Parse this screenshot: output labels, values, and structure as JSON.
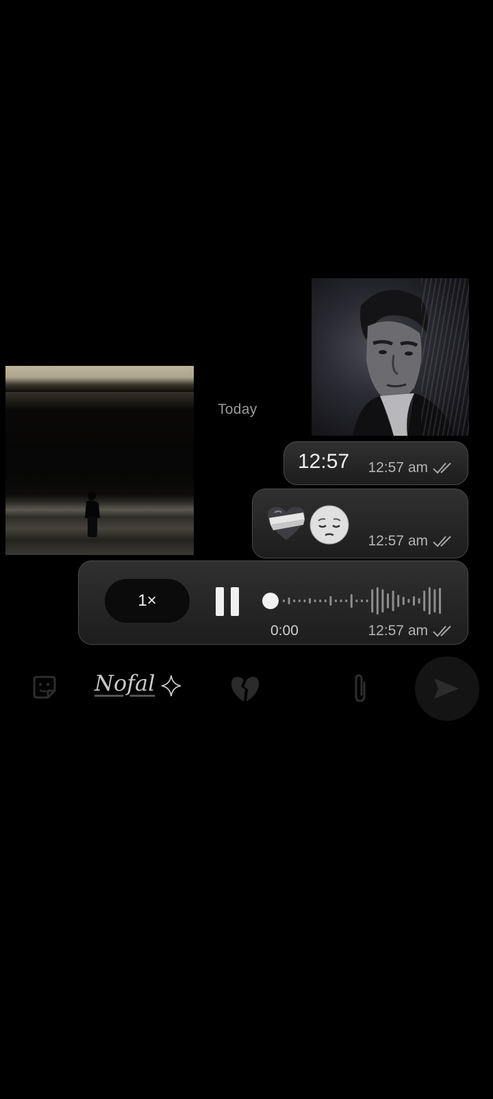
{
  "chat": {
    "date_separator": "Today",
    "messages": [
      {
        "type": "image",
        "side": "right",
        "description_icon": "portrait-photo"
      },
      {
        "type": "image",
        "side": "left",
        "description_icon": "beach-photo"
      },
      {
        "type": "text",
        "side": "right",
        "text": "12:57",
        "time": "12:57 am",
        "status": "read"
      },
      {
        "type": "emoji",
        "side": "right",
        "emojis": [
          "mending-heart-emoji",
          "pensive-face-emoji"
        ],
        "time": "12:57 am",
        "status": "read"
      },
      {
        "type": "voice",
        "side": "right",
        "speed": "1×",
        "state": "playing",
        "duration": "0:00",
        "progress": 0,
        "time": "12:57 am",
        "status": "read"
      }
    ]
  },
  "composer": {
    "draft_text": "Nofal",
    "icons": [
      "sticker-icon",
      "sparkle-icon",
      "broken-heart-icon",
      "attach-icon",
      "send-icon"
    ]
  },
  "colors": {
    "background": "#000000",
    "bubble": "#262626",
    "bubble_border": "#4a4a4a",
    "meta_text": "#b5b5b5",
    "date_text": "#9a9a9a"
  }
}
